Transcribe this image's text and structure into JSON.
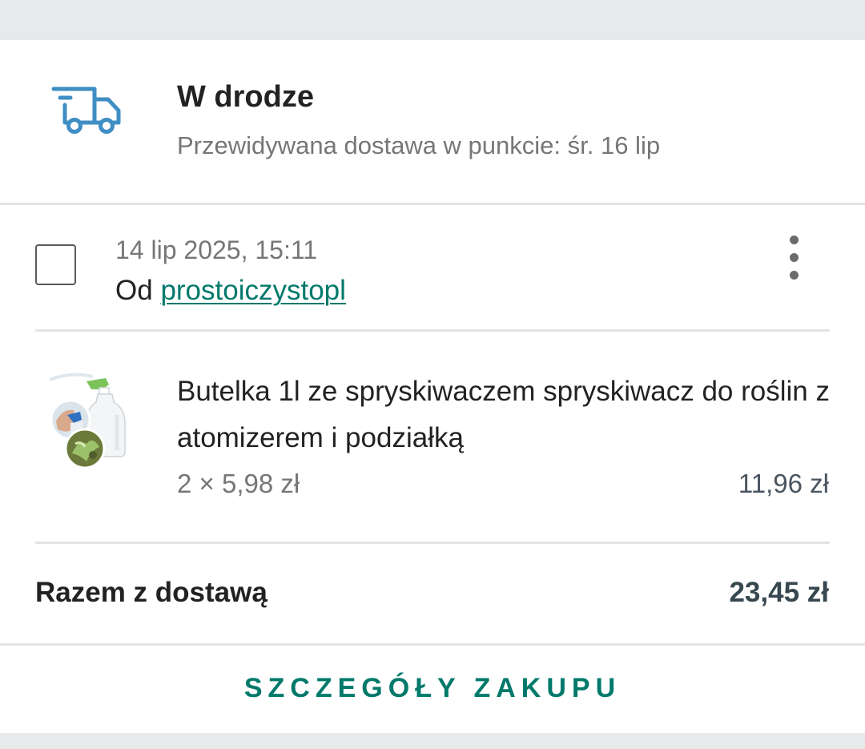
{
  "status": {
    "icon": "truck-icon",
    "title": "W drodze",
    "subtitle": "Przewidywana dostawa w punkcie: śr. 16 lip",
    "icon_color": "#3f8ec4"
  },
  "order": {
    "date": "14 lip 2025, 15:11",
    "seller_prefix": "Od",
    "seller_name": "prostoiczystopl",
    "selected": false
  },
  "item": {
    "title": "Butelka 1l ze spryskiwaczem spryskiwacz do roślin z atomizerem i podziałką",
    "quantity_price": "2 × 5,98 zł",
    "line_total": "11,96 zł",
    "image": "spray-bottle-thumbnail"
  },
  "summary": {
    "label": "Razem z dostawą",
    "value": "23,45 zł"
  },
  "actions": {
    "details_label": "SZCZEGÓŁY ZAKUPU"
  },
  "colors": {
    "accent": "#00796b",
    "background": "#e7e9eb",
    "card": "#ffffff"
  }
}
